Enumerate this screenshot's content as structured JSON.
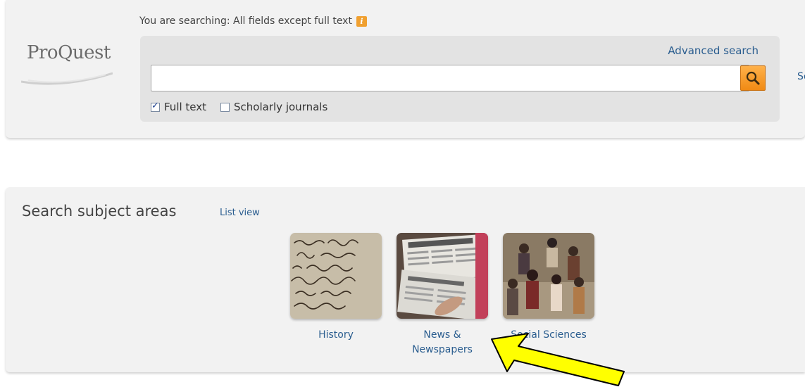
{
  "header": {
    "logo_text": "ProQuest",
    "searching_prefix": "You are searching: All fields except full text",
    "info_icon": "info-icon",
    "advanced_search_label": "Advanced search",
    "search_input_value": "",
    "search_button_icon": "search-icon",
    "full_text_label": "Full text",
    "full_text_checked": true,
    "scholarly_label": "Scholarly journals",
    "scholarly_checked": false,
    "right_cut_text": "Se"
  },
  "subjects": {
    "title": "Search subject areas",
    "list_view_label": "List view",
    "tiles": [
      {
        "label": "History",
        "image": "manuscript-image"
      },
      {
        "label": "News & Newspapers",
        "image": "newspaper-image",
        "label_lines": [
          "News &",
          "Newspapers"
        ]
      },
      {
        "label": "Social Sciences",
        "image": "crowd-image"
      }
    ]
  },
  "colors": {
    "link": "#2a5d8f",
    "panel_bg": "#f2f2f2",
    "search_button": "#f08a14",
    "arrow_fill": "#ffff00"
  }
}
